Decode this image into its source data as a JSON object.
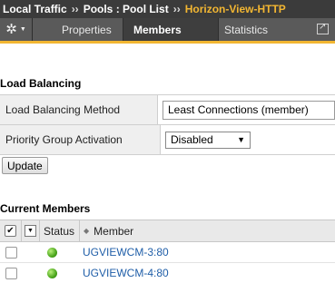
{
  "breadcrumb": {
    "items": [
      "Local Traffic",
      "Pools : Pool List",
      "Horizon-View-HTTP"
    ],
    "separator": "››"
  },
  "tabs": {
    "gear_icon": "gear-icon",
    "items": [
      "Properties",
      "Members",
      "Statistics"
    ],
    "active": "Members"
  },
  "load_balancing": {
    "title": "Load Balancing",
    "rows": [
      {
        "label": "Load Balancing Method",
        "value": "Least Connections (member)"
      },
      {
        "label": "Priority Group Activation",
        "value": "Disabled"
      }
    ],
    "update_label": "Update"
  },
  "members": {
    "title": "Current Members",
    "columns": {
      "status": "Status",
      "member": "Member"
    },
    "rows": [
      {
        "status": "green",
        "member": "UGVIEWCM-3:80"
      },
      {
        "status": "green",
        "member": "UGVIEWCM-4:80"
      }
    ]
  },
  "colors": {
    "accent": "#f2b632",
    "header_bg": "#3b3b3b",
    "link": "#1f5ea8",
    "status_available": "#4aa51c"
  }
}
